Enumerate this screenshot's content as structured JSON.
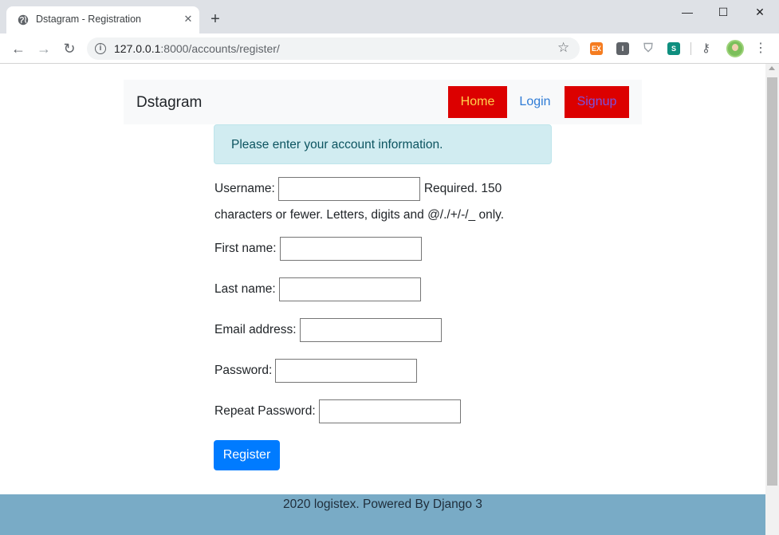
{
  "browser": {
    "tab_title": "Dstagram - Registration",
    "tab_close": "✕",
    "new_tab": "+",
    "window_controls": {
      "minimize": "—",
      "maximize": "☐",
      "close": "✕"
    },
    "url_host": "127.0.0.1",
    "url_rest": ":8000/accounts/register/",
    "icons": {
      "back": "←",
      "forward": "→",
      "reload": "↻",
      "info": "i",
      "star": "☆",
      "key": "⚷",
      "menu": "⋮"
    },
    "extensions": {
      "ex": "EX",
      "i": "I",
      "shield": "⛉",
      "s": "S"
    }
  },
  "navbar": {
    "brand": "Dstagram",
    "links": {
      "home": "Home",
      "login": "Login",
      "signup": "Signup"
    },
    "colors": {
      "home_bg": "#dc0000",
      "signup_bg": "#dc0000",
      "login_text": "#2f7cd6"
    }
  },
  "alert": {
    "message": "Please enter your account information."
  },
  "form": {
    "username": {
      "label": "Username:",
      "value": "",
      "help_line1": "Required. 150",
      "help_line2": "characters or fewer. Letters, digits and @/./+/-/_ only."
    },
    "first_name": {
      "label": "First name:",
      "value": ""
    },
    "last_name": {
      "label": "Last name:",
      "value": ""
    },
    "email": {
      "label": "Email address:",
      "value": ""
    },
    "password": {
      "label": "Password:",
      "value": ""
    },
    "password2": {
      "label": "Repeat Password:",
      "value": ""
    },
    "submit_label": "Register"
  },
  "footer": {
    "text": "2020 logistex. Powered By Django 3"
  },
  "colors": {
    "accent": "#007bff",
    "footer_bg": "#79abc6",
    "alert_bg": "#d1ecf1"
  }
}
